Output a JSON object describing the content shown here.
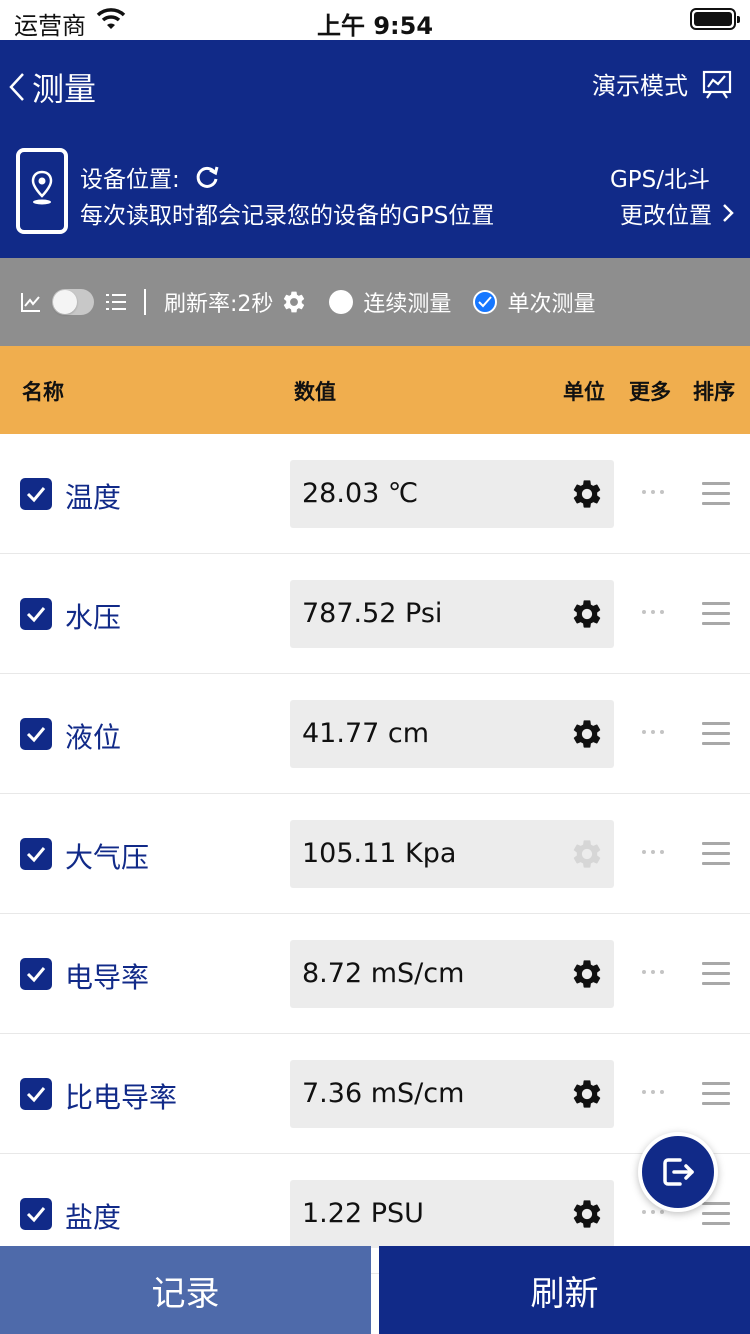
{
  "status_bar": {
    "carrier": "运营商",
    "time": "上午 9:54"
  },
  "nav": {
    "title": "测量",
    "demo_mode": "演示模式"
  },
  "location": {
    "label": "设备位置:",
    "description": "每次读取时都会记录您的设备的GPS位置",
    "gps": "GPS/北斗",
    "change": "更改位置"
  },
  "toolbar": {
    "refresh_rate": "刷新率:2秒",
    "continuous": "连续测量",
    "single": "单次测量",
    "selected_mode": "single"
  },
  "table_header": {
    "name": "名称",
    "value": "数值",
    "unit": "单位",
    "more": "更多",
    "sort": "排序"
  },
  "rows": [
    {
      "name": "温度",
      "value": "28.03 ℃",
      "checked": true,
      "unit_enabled": true
    },
    {
      "name": "水压",
      "value": "787.52 Psi",
      "checked": true,
      "unit_enabled": true
    },
    {
      "name": "液位",
      "value": "41.77 cm",
      "checked": true,
      "unit_enabled": true
    },
    {
      "name": "大气压",
      "value": "105.11 Kpa",
      "checked": true,
      "unit_enabled": false
    },
    {
      "name": "电导率",
      "value": "8.72 mS/cm",
      "checked": true,
      "unit_enabled": true
    },
    {
      "name": "比电导率",
      "value": "7.36 mS/cm",
      "checked": true,
      "unit_enabled": true
    },
    {
      "name": "盐度",
      "value": "1.22 PSU",
      "checked": true,
      "unit_enabled": true
    }
  ],
  "bottom": {
    "record": "记录",
    "refresh": "刷新"
  },
  "colors": {
    "primary": "#112a88",
    "header_row": "#f0ae4e",
    "toolbar": "#8e8e8e",
    "record_button": "#4e6aaa",
    "radio_checked": "#1677ff"
  },
  "icons": [
    "back-chevron-icon",
    "chart-icon",
    "phone-location-icon",
    "refresh-icon",
    "chevron-right-icon",
    "line-chart-icon",
    "list-icon",
    "gear-icon",
    "checkbox-icon",
    "more-icon",
    "drag-handle-icon",
    "exit-icon"
  ]
}
